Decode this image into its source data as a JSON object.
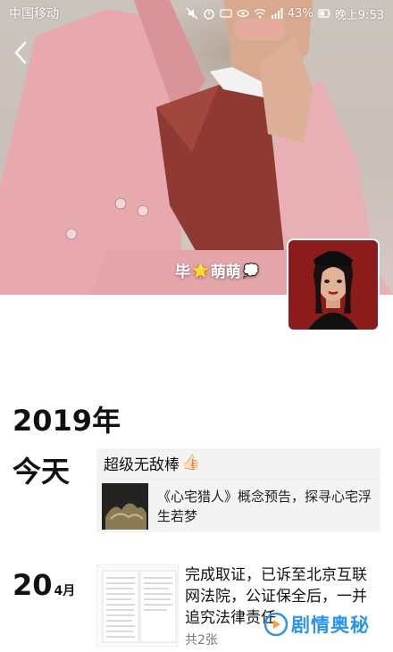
{
  "status_bar": {
    "carrier": "中国移动",
    "battery": "43%",
    "time": "晚上9:53"
  },
  "profile": {
    "nickname": "毕",
    "nickname_suffix": "萌萌",
    "emoji_star": "🌟",
    "emoji_cloud": "💭"
  },
  "timeline": {
    "year": "2019年",
    "entries": [
      {
        "day": "今天",
        "text": "超级无敌棒",
        "emoji": "👍🏻",
        "link_title": "《心宅猎人》概念预告，探寻心宅浮生若梦"
      },
      {
        "day": "20",
        "month": "4月",
        "text": "完成取证，已诉至北京互联网法院，公证保全后，一并追究法律责任",
        "image_count": "共2张"
      }
    ]
  },
  "watermark": {
    "text": "剧情奥秘"
  },
  "colors": {
    "watermark": "#2b95e9",
    "card_bg": "#f3f3f3",
    "avatar_bg": "#8c1c1c"
  }
}
